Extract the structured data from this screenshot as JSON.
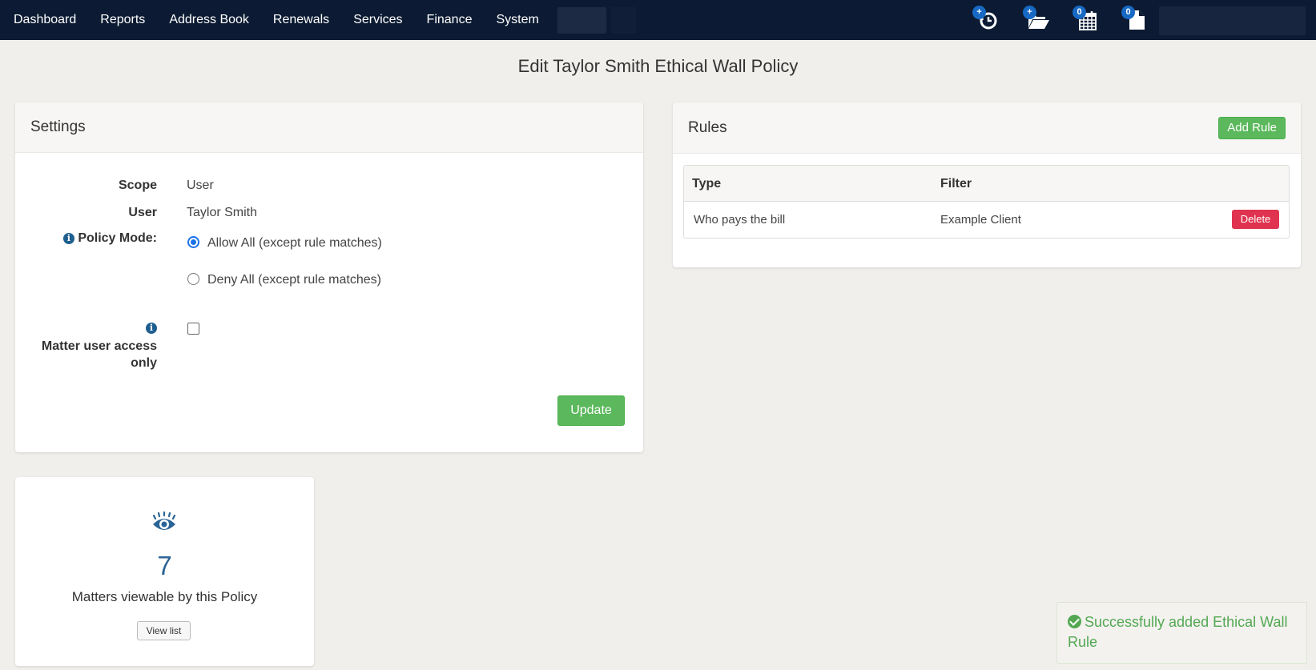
{
  "nav": {
    "links": [
      "Dashboard",
      "Reports",
      "Address Book",
      "Renewals",
      "Services",
      "Finance",
      "System"
    ],
    "icons": [
      {
        "name": "history-icon",
        "badge": "+"
      },
      {
        "name": "folder-open-icon",
        "badge": "+"
      },
      {
        "name": "calendar-icon",
        "badge": "0"
      },
      {
        "name": "document-icon",
        "badge": "0"
      }
    ]
  },
  "page": {
    "title": "Edit Taylor Smith Ethical Wall Policy"
  },
  "settings": {
    "title": "Settings",
    "scope_label": "Scope",
    "scope_value": "User",
    "user_label": "User",
    "user_value": "Taylor Smith",
    "policy_mode_label": "Policy Mode:",
    "policy_mode_options": [
      "Allow All (except rule matches)",
      "Deny All (except rule matches)"
    ],
    "policy_mode_selected": "Allow All (except rule matches)",
    "matter_access_label_line1": "Matter user access",
    "matter_access_label_line2": "only",
    "matter_access_checked": false,
    "update_label": "Update"
  },
  "rules": {
    "title": "Rules",
    "add_label": "Add Rule",
    "columns": [
      "Type",
      "Filter"
    ],
    "rows": [
      {
        "type": "Who pays the bill",
        "filter": "Example Client",
        "action": "Delete"
      }
    ]
  },
  "matters": {
    "count": "7",
    "caption": "Matters viewable by this Policy",
    "view_label": "View list"
  },
  "toast": {
    "message": "Successfully added Ethical Wall Rule"
  },
  "colors": {
    "nav_bg": "#0c1b33",
    "page_bg": "#f1efec",
    "accent_green": "#5cb85c",
    "danger_red": "#e0334f",
    "link_blue": "#2a6496"
  }
}
